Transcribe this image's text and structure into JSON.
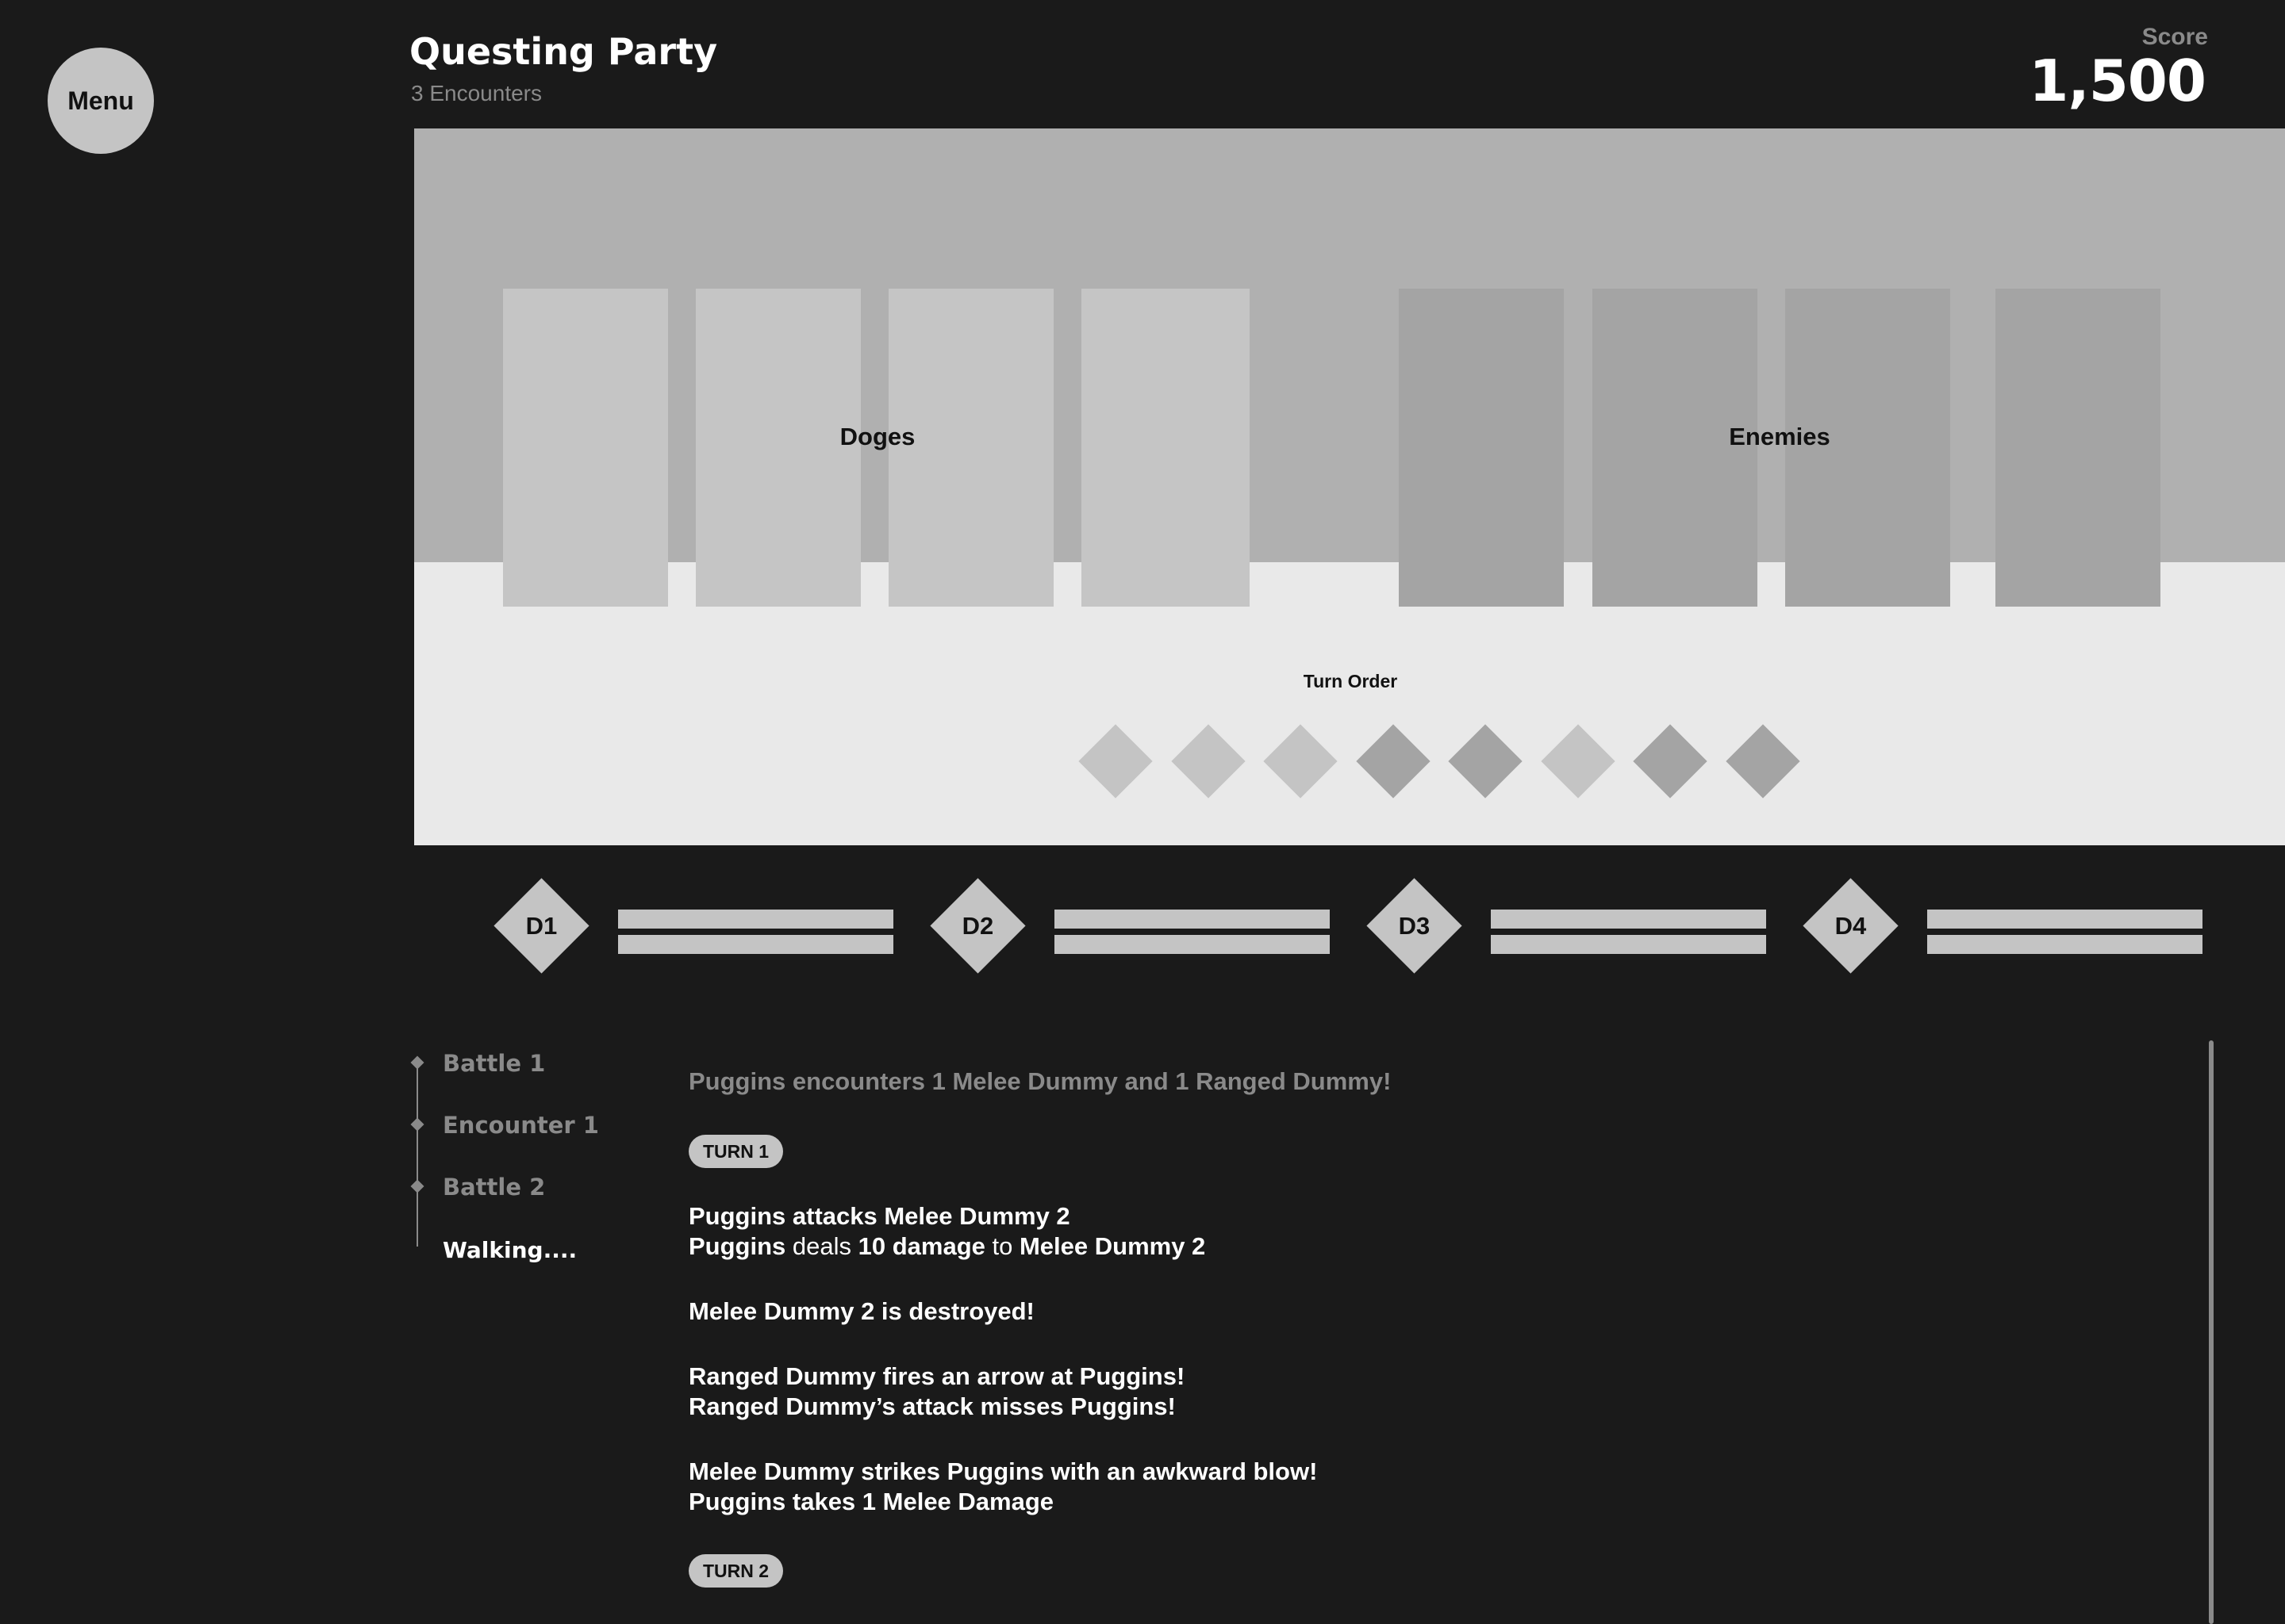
{
  "menu": {
    "label": "Menu"
  },
  "header": {
    "title": "Questing Party",
    "subtitle": "3 Encounters"
  },
  "score": {
    "label": "Score",
    "value": "1,500"
  },
  "stage": {
    "doges_label": "Doges",
    "enemies_label": "Enemies",
    "turn_order_label": "Turn Order",
    "turn_order": [
      "doge",
      "doge",
      "doge",
      "enemy",
      "enemy",
      "doge",
      "enemy",
      "enemy"
    ]
  },
  "party": [
    {
      "id": "D1"
    },
    {
      "id": "D2"
    },
    {
      "id": "D3"
    },
    {
      "id": "D4"
    }
  ],
  "timeline": {
    "items": [
      "Battle 1",
      "Encounter 1",
      "Battle 2",
      "Walking...."
    ]
  },
  "log": {
    "intro": "Puggins encounters 1 Melee Dummy and 1 Ranged Dummy!",
    "turn1": "TURN 1",
    "turn2": "TURN 2",
    "l1": "Puggins attacks Melee Dummy 2",
    "l2a": "Puggins",
    "l2b": " deals ",
    "l2c": "10 damage",
    "l2d": " to ",
    "l2e": "Melee Dummy 2",
    "l3": "Melee Dummy 2 is destroyed!",
    "l4": "Ranged Dummy fires an arrow at Puggins!",
    "l5": "Ranged Dummy’s attack misses Puggins!",
    "l6": "Melee Dummy strikes Puggins with an awkward blow!",
    "l7": "Puggins takes 1 Melee Damage"
  },
  "colors": {
    "background": "#1a1a1a",
    "doge_slot": "#c5c5c5",
    "enemy_slot": "#a4a4a4",
    "muted_text": "#8a8a8a"
  }
}
